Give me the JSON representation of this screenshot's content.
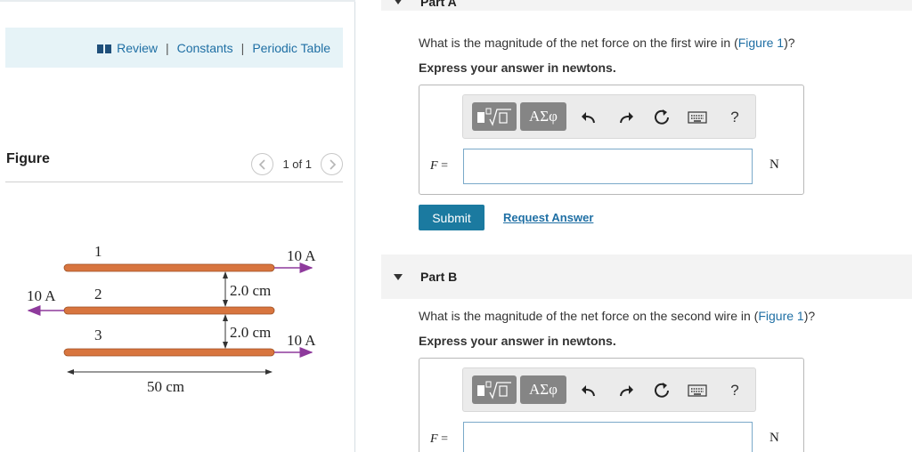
{
  "resources": {
    "review": "Review",
    "constants": "Constants",
    "periodic_table": "Periodic Table",
    "separator": "|"
  },
  "figure_panel": {
    "title": "Figure",
    "pager": "1 of 1",
    "prev_icon": "chevron-left-icon",
    "next_icon": "chevron-right-icon"
  },
  "figure": {
    "wire_labels": [
      "1",
      "2",
      "3"
    ],
    "currents": [
      "10 A",
      "10 A",
      "10 A"
    ],
    "spacings": [
      "2.0 cm",
      "2.0 cm"
    ],
    "length": "50 cm",
    "wire_color": "#d8753f",
    "arrow_color": "#8e3a9c"
  },
  "part_a": {
    "title": "Part A",
    "question_prefix": "What is the magnitude of the net force on the first wire in (",
    "figure_link": "Figure 1",
    "question_suffix": ")?",
    "instruction": "Express your answer in newtons.",
    "variable": "F",
    "equals": "=",
    "unit": "N",
    "input_value": "",
    "submit": "Submit",
    "request_answer": "Request Answer"
  },
  "part_b": {
    "title": "Part B",
    "question_prefix": "What is the magnitude of the net force on the second wire in (",
    "figure_link": "Figure 1",
    "question_suffix": ")?",
    "instruction": "Express your answer in newtons.",
    "variable": "F",
    "equals": "=",
    "unit": "N",
    "input_value": ""
  },
  "toolbar": {
    "greek_label": "ΑΣφ",
    "help_label": "?",
    "icons": [
      "templates-icon",
      "greek-symbols-icon",
      "undo-icon",
      "redo-icon",
      "reset-icon",
      "keyboard-icon",
      "help-icon"
    ]
  },
  "colors": {
    "link": "#1f6fa4",
    "submit_bg": "#1b7aa0",
    "resource_bar_bg": "#e6f3f7",
    "toolbar_dark": "#858585"
  }
}
